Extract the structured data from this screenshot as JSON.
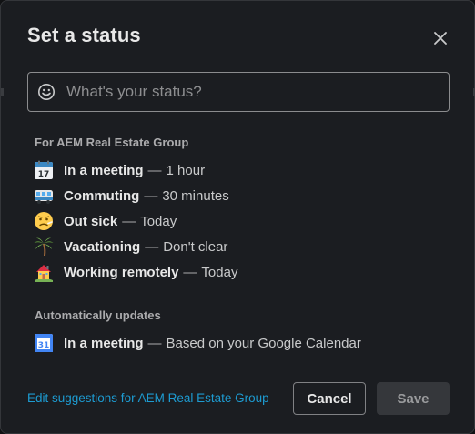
{
  "dialog": {
    "title": "Set a status",
    "close_icon": "close-icon"
  },
  "status_input": {
    "placeholder": "What's your status?",
    "value": "",
    "icon": "smile-icon"
  },
  "presets": {
    "section_label": "For AEM Real Estate Group",
    "items": [
      {
        "icon": "calendar-icon",
        "name": "In a meeting",
        "separator": "—",
        "duration": "1 hour"
      },
      {
        "icon": "bus-icon",
        "name": "Commuting",
        "separator": "—",
        "duration": "30 minutes"
      },
      {
        "icon": "sick-face-icon",
        "name": "Out sick",
        "separator": "—",
        "duration": "Today"
      },
      {
        "icon": "palm-tree-icon",
        "name": "Vacationing",
        "separator": "—",
        "duration": "Don't clear"
      },
      {
        "icon": "house-icon",
        "name": "Working remotely",
        "separator": "—",
        "duration": "Today"
      }
    ]
  },
  "auto_updates": {
    "section_label": "Automatically updates",
    "items": [
      {
        "icon": "google-calendar-icon",
        "calendar_day": "31",
        "name": "In a meeting",
        "separator": "—",
        "duration": "Based on your Google Calendar"
      }
    ]
  },
  "footer": {
    "edit_link": "Edit suggestions for AEM Real Estate Group",
    "cancel_label": "Cancel",
    "save_label": "Save"
  },
  "colors": {
    "background": "#1b1d21",
    "link": "#1d9bd1",
    "text_primary": "#e8e8e8",
    "text_secondary": "#ababad"
  }
}
